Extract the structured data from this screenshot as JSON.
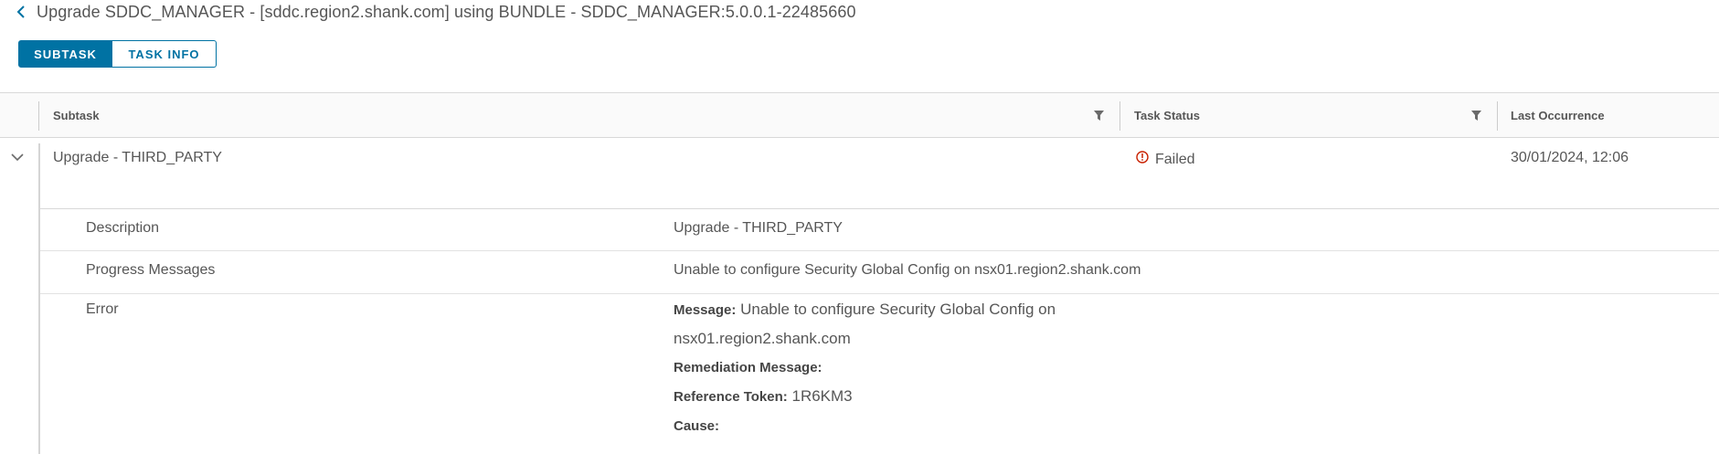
{
  "header": {
    "back_icon": "chevron-left-icon",
    "title": "Upgrade SDDC_MANAGER - [sddc.region2.shank.com] using BUNDLE - SDDC_MANAGER:5.0.0.1-22485660"
  },
  "tabs": [
    {
      "label": "SUBTASK",
      "active": true
    },
    {
      "label": "TASK INFO",
      "active": false
    }
  ],
  "grid": {
    "columns": [
      {
        "label": "Subtask",
        "filter_icon": "filter-icon"
      },
      {
        "label": "Task Status",
        "filter_icon": "filter-icon"
      },
      {
        "label": "Last Occurrence"
      }
    ],
    "rows": [
      {
        "expand_icon": "chevron-down-icon",
        "subtask": "Upgrade - THIRD_PARTY",
        "status": "Failed",
        "status_icon": "error-circle-icon",
        "status_color": "#c92100",
        "last_occurrence": "30/01/2024, 12:06",
        "details": {
          "description_label": "Description",
          "description_value": "Upgrade - THIRD_PARTY",
          "progress_label": "Progress Messages",
          "progress_value": "Unable to configure Security Global Config on nsx01.region2.shank.com",
          "error_label": "Error",
          "error": {
            "message_key": "Message:",
            "message_line1": "Unable to configure Security Global Config on",
            "message_line2": "nsx01.region2.shank.com",
            "remediation_key": "Remediation Message:",
            "remediation_value": "",
            "reference_key": "Reference Token:",
            "reference_value": "1R6KM3",
            "cause_key": "Cause:",
            "cause_value": ""
          }
        }
      }
    ]
  },
  "colors": {
    "accent": "#0072a3",
    "error": "#c92100"
  }
}
